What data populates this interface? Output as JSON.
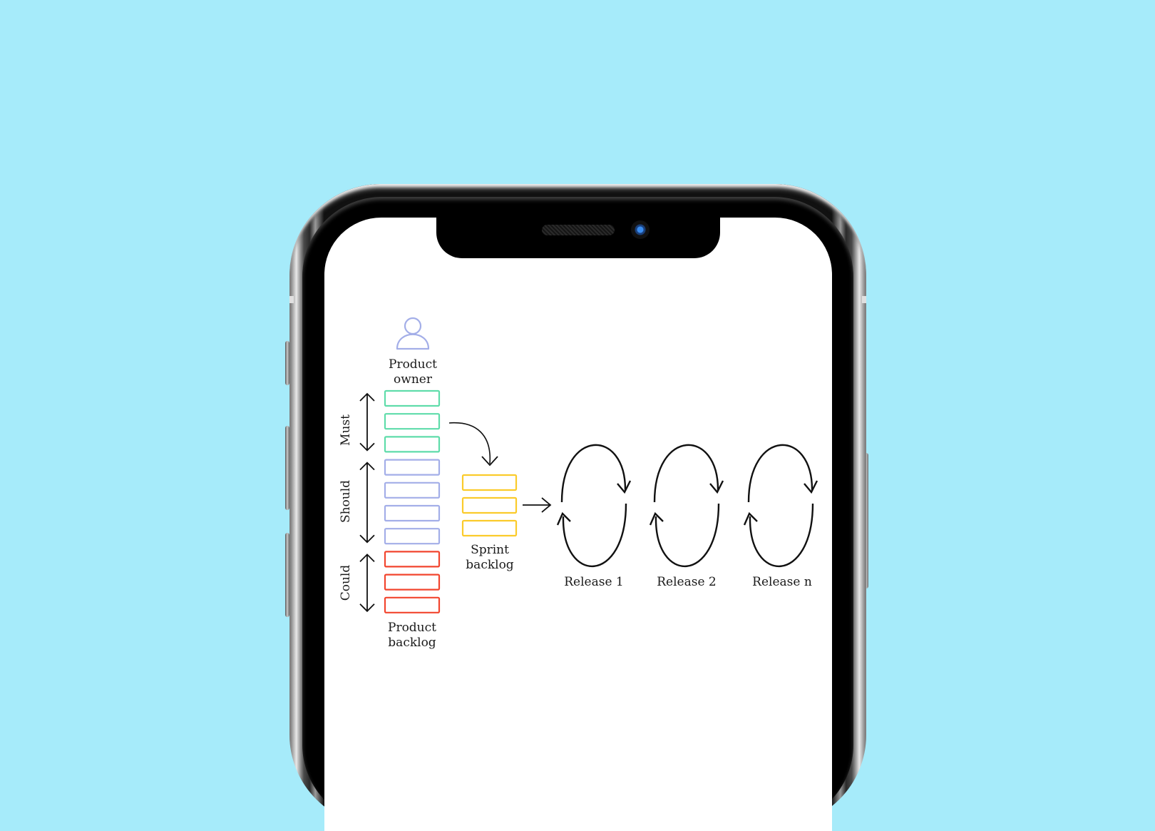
{
  "device": {
    "type": "smartphone",
    "frame_color": "#9a9a9a",
    "background_color": "#a6ebfa"
  },
  "diagram": {
    "product_owner": {
      "icon": "person-icon",
      "label_line1": "Product",
      "label_line2": "owner",
      "color": "#a3aee8"
    },
    "priorities": [
      {
        "label": "Must",
        "color": "#5fdcaa",
        "items": 3
      },
      {
        "label": "Should",
        "color": "#a3aee8",
        "items": 4
      },
      {
        "label": "Could",
        "color": "#f2452e",
        "items": 3
      }
    ],
    "product_backlog": {
      "label_line1": "Product",
      "label_line2": "backlog"
    },
    "sprint_backlog": {
      "label_line1": "Sprint",
      "label_line2": "backlog",
      "color": "#fbcb2b",
      "items": 3
    },
    "releases": [
      {
        "label": "Release 1"
      },
      {
        "label": "Release 2"
      },
      {
        "label": "Release n"
      }
    ]
  }
}
